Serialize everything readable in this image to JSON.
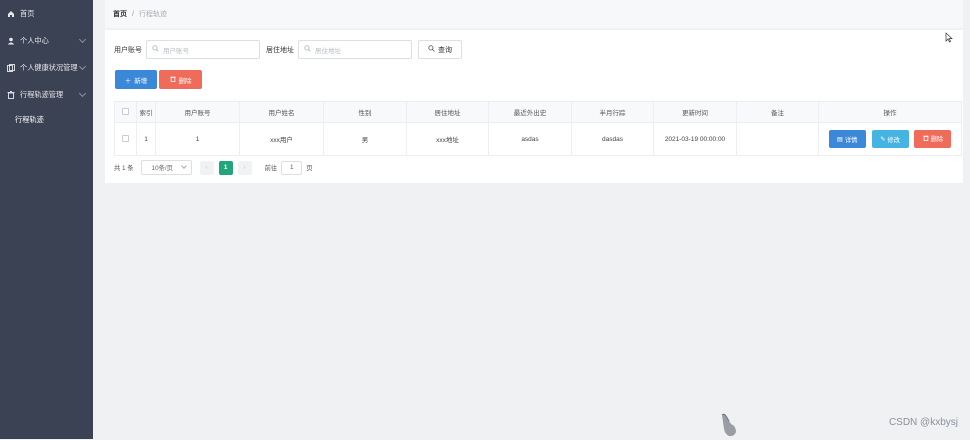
{
  "sidebar": {
    "items": [
      {
        "label": "首页",
        "icon": "home-icon",
        "chevron": false
      },
      {
        "label": "个人中心",
        "icon": "user-icon",
        "chevron": true
      },
      {
        "label": "个人健康状况管理",
        "icon": "copy-icon",
        "chevron": true
      },
      {
        "label": "行程轨迹管理",
        "icon": "trash-icon",
        "chevron": true
      }
    ],
    "subitem": "行程轨迹"
  },
  "breadcrumb": {
    "home": "首页",
    "separator": "/",
    "current": "行程轨迹"
  },
  "search": {
    "account_label": "用户账号",
    "account_placeholder": "用户账号",
    "address_label": "居住地址",
    "address_placeholder": "居住地址",
    "query_label": "查询"
  },
  "actions": {
    "add_label": "新增",
    "delete_label": "删除"
  },
  "table": {
    "headers": [
      "",
      "索引",
      "用户账号",
      "用户姓名",
      "性别",
      "居住地址",
      "最近外出史",
      "半月行踪",
      "更新时间",
      "备注",
      "操作"
    ],
    "rows": [
      {
        "index": "1",
        "account": "1",
        "name": "xxx用户",
        "gender": "男",
        "address": "xxx地址",
        "recent_trip": "asdas",
        "half_month": "dasdas",
        "updated": "2021-03-19 00:00:00",
        "remark": ""
      }
    ],
    "op_detail": "详情",
    "op_edit": "修改",
    "op_delete": "删除"
  },
  "pagination": {
    "total": "共 1 条",
    "page_size": "10条/页",
    "current_page": "1",
    "goto_label": "前往",
    "goto_value": "1",
    "page_unit": "页"
  },
  "watermark": "CSDN @kxbysj",
  "colors": {
    "sidebar_bg": "#3b4253",
    "primary": "#3b88d8",
    "danger": "#f06c5a",
    "info": "#45b4e3",
    "active_page": "#21a67a"
  }
}
